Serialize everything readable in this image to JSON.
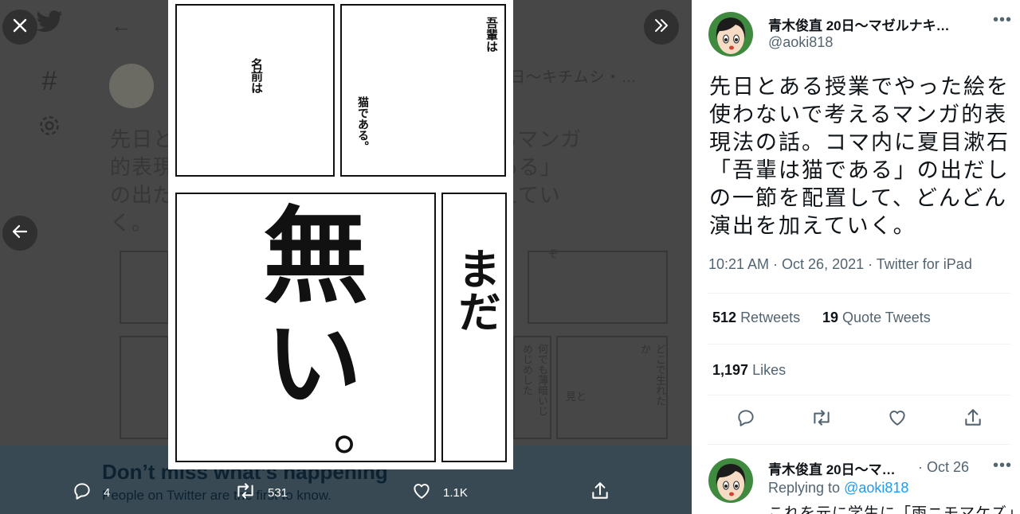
{
  "viewer": {
    "background": {
      "author_handle_partial": "日～キチムシ・…",
      "text_lines": [
        "先日と　　　　　　　　　　　　で考えるマンガ",
        "的表現　　　　　　　　　　　輩は猫である」",
        "の出だ　　　　　　　　　　　演出を加えてい",
        "く。"
      ],
      "panel_texts": [
        "ぞ",
        "何でも薄暗いじめじめした",
        "見と",
        "どこで生れたか"
      ],
      "banner_title": "Don’t miss what’s happening",
      "banner_subtitle": "People on Twitter are the first to know."
    },
    "manga": {
      "top_left_text": "名前は",
      "top_right_text_1": "吾輩は",
      "top_right_text_2": "猫である。",
      "big_text_1": "無",
      "big_text_2": "い",
      "big_text_3": "。",
      "right_text": "まだ"
    },
    "actions": {
      "reply_count": "4",
      "retweet_count": "531",
      "like_count": "1.1K"
    }
  },
  "tweet": {
    "author_name": "青木俊直 20日～マゼルナキ…",
    "author_handle": "@aoki818",
    "text": "先日とある授業でやった絵を使わないで考えるマンガ的表現法の話。コマ内に夏目漱石「吾輩は猫である」の出だしの一節を配置して、どんどん演出を加えていく。",
    "timestamp": "10:21 AM · Oct 26, 2021 · Twitter for iPad",
    "retweets_count": "512",
    "retweets_label": "Retweets",
    "quote_count": "19",
    "quote_label": "Quote Tweets",
    "likes_count": "1,197",
    "likes_label": "Likes"
  },
  "reply": {
    "author_name": "青木俊直 20日～マ…",
    "date": "· Oct 26",
    "replying_label": "Replying to",
    "replying_handle": "@aoki818",
    "text": "これを元に学生に「雨ニモマケズ」"
  },
  "colors": {
    "accent": "#1d9bf0",
    "text": "#0f1419",
    "muted": "#536471",
    "overlay": "#474747"
  },
  "icons": [
    "close-icon",
    "twitter-logo-icon",
    "back-arrow-icon",
    "hashtag-icon",
    "settings-icon",
    "collapse-panel-icon",
    "previous-image-icon",
    "reply-icon",
    "retweet-icon",
    "like-icon",
    "share-icon",
    "more-icon"
  ]
}
